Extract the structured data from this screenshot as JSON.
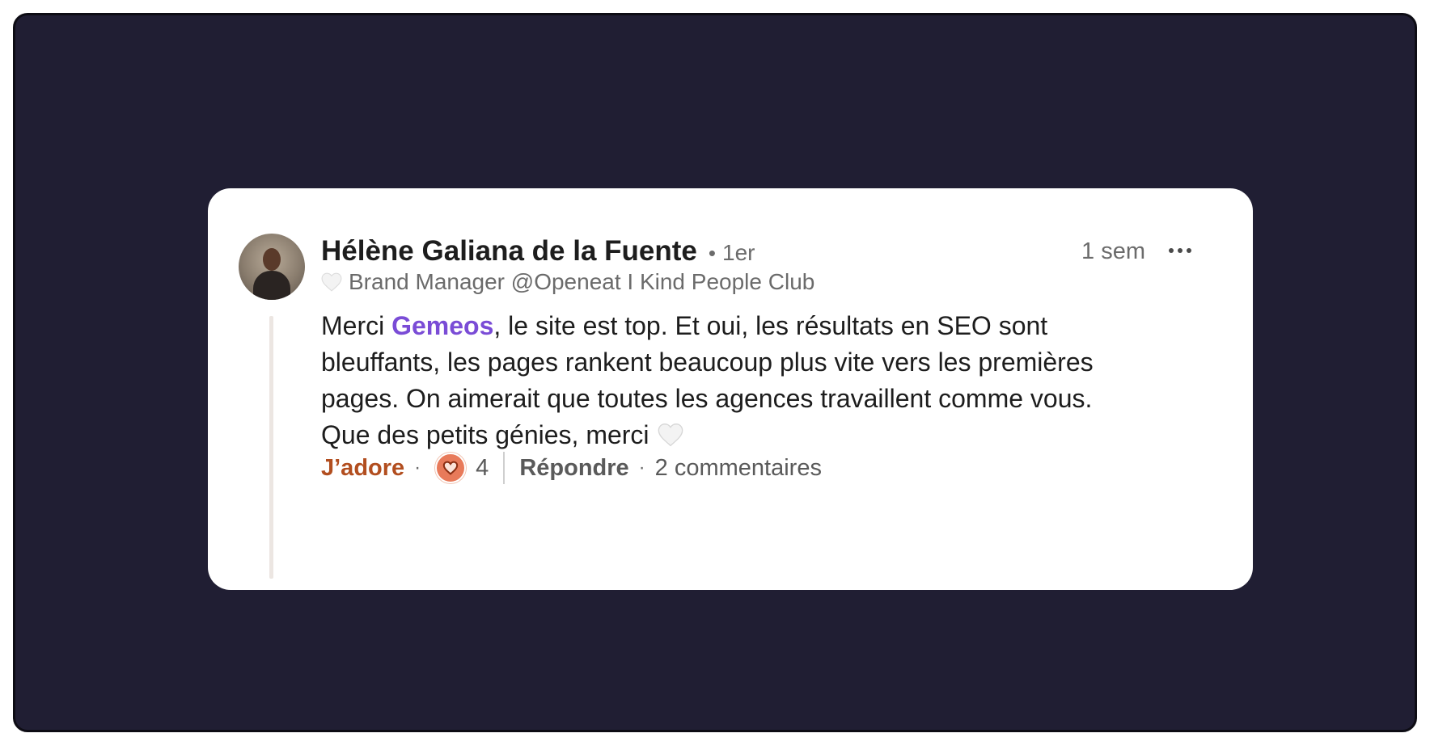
{
  "comment": {
    "author_name": "Hélène Galiana de la Fuente",
    "connection_degree": "1er",
    "separator": "•",
    "timestamp": "1 sem",
    "headline": "Brand Manager @Openeat I Kind People Club",
    "text_before_mention": "Merci ",
    "mention": "Gemeos",
    "text_after_mention": ", le site est top. Et oui, les résultats en SEO sont bleuffants, les pages rankent beaucoup plus vite vers les premières pages. On aimerait que toutes les agences travaillent comme vous. Que des petits génies, merci"
  },
  "actions": {
    "like_label": "J’adore",
    "dot": "·",
    "reaction_count": "4",
    "reply_label": "Répondre",
    "comments_label": "2 commentaires"
  },
  "colors": {
    "background": "#201e33",
    "card": "#ffffff",
    "mention": "#7a4cd6",
    "like_active": "#b24e1f",
    "reaction_love": "#e87a5a"
  },
  "icons": {
    "more": "more-horizontal-icon",
    "reaction": "love-reaction-icon",
    "emoji": "white-heart-emoji-icon"
  }
}
